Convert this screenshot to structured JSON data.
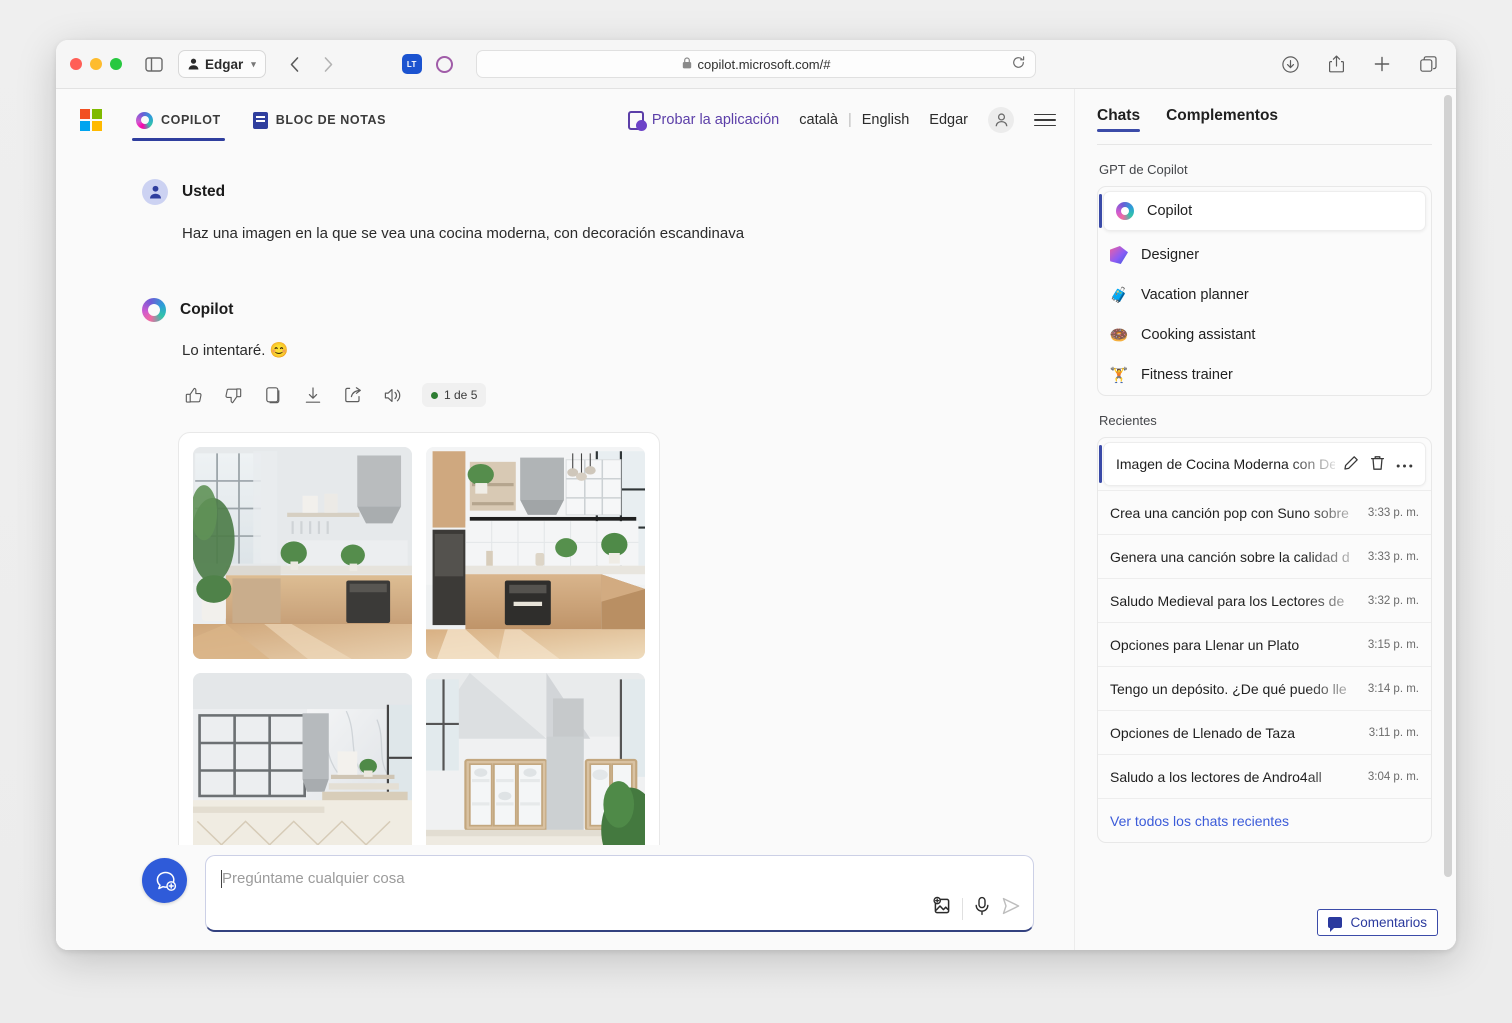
{
  "browser": {
    "profile_name": "Edgar",
    "url": "copilot.microsoft.com/#",
    "lock_icon": "lock-icon",
    "reload_icon": "reload-icon",
    "back_icon": "chevron-left-icon",
    "forward_icon": "chevron-right-icon",
    "sidebar_icon": "sidebar-toggle-icon",
    "extension_lt_label": "LT",
    "extension_circle_icon": "circle-icon",
    "right_icons": [
      "download-icon",
      "share-icon",
      "new-tab-icon",
      "tab-overview-icon"
    ]
  },
  "app_header": {
    "logo": "microsoft-logo",
    "tabs": [
      {
        "label": "COPILOT",
        "icon": "copilot-icon",
        "active": true
      },
      {
        "label": "BLOC DE NOTAS",
        "icon": "notebook-icon",
        "active": false
      }
    ],
    "try_app_label": "Probar la aplicación",
    "try_app_icon": "mobile-app-icon",
    "languages": [
      "català",
      "English"
    ],
    "language_separator": "|",
    "user_name": "Edgar",
    "avatar_icon": "person-icon",
    "menu_icon": "hamburger-menu-icon"
  },
  "conversation": {
    "user": {
      "author": "Usted",
      "avatar_icon": "user-avatar-icon",
      "text": "Haz una imagen en la que se vea una cocina moderna, con decoración escandinava"
    },
    "assistant": {
      "author": "Copilot",
      "avatar_icon": "copilot-avatar-icon",
      "text": "Lo intentaré. 😊",
      "actions": [
        {
          "name": "thumbs-up-icon"
        },
        {
          "name": "thumbs-down-icon"
        },
        {
          "name": "copy-icon"
        },
        {
          "name": "download-icon"
        },
        {
          "name": "share-icon"
        },
        {
          "name": "speaker-icon"
        }
      ],
      "counter_badge": "1 de 5",
      "images": [
        {
          "alt": "cocina-moderna-1"
        },
        {
          "alt": "cocina-moderna-2"
        },
        {
          "alt": "cocina-moderna-3"
        },
        {
          "alt": "cocina-moderna-4"
        }
      ]
    }
  },
  "composer": {
    "new_chat_icon": "new-chat-icon",
    "placeholder": "Pregúntame cualquier cosa",
    "value": "",
    "tools": [
      {
        "name": "add-image-icon"
      },
      {
        "name": "microphone-icon"
      },
      {
        "name": "send-icon"
      }
    ]
  },
  "sidebar": {
    "tabs": [
      {
        "label": "Chats",
        "active": true
      },
      {
        "label": "Complementos",
        "active": false
      }
    ],
    "gpt_section_label": "GPT de Copilot",
    "gpts": [
      {
        "label": "Copilot",
        "icon": "copilot-icon",
        "selected": true
      },
      {
        "label": "Designer",
        "icon": "designer-icon",
        "selected": false
      },
      {
        "label": "Vacation planner",
        "icon": "🧳",
        "selected": false
      },
      {
        "label": "Cooking assistant",
        "icon": "🍩",
        "selected": false
      },
      {
        "label": "Fitness trainer",
        "icon": "🏋",
        "selected": false
      }
    ],
    "recent_section_label": "Recientes",
    "recents": [
      {
        "title": "Imagen de Cocina Moderna con Decoración",
        "time": "",
        "selected": true,
        "actions": [
          "edit-icon",
          "delete-icon",
          "more-options-icon"
        ]
      },
      {
        "title": "Crea una canción pop con Suno sobre",
        "time": "3:33 p. m.",
        "selected": false
      },
      {
        "title": "Genera una canción sobre la calidad d",
        "time": "3:33 p. m.",
        "selected": false
      },
      {
        "title": "Saludo Medieval para los Lectores de",
        "time": "3:32 p. m.",
        "selected": false
      },
      {
        "title": "Opciones para Llenar un Plato",
        "time": "3:15 p. m.",
        "selected": false
      },
      {
        "title": "Tengo un depósito. ¿De qué puedo lle",
        "time": "3:14 p. m.",
        "selected": false
      },
      {
        "title": "Opciones de Llenado de Taza",
        "time": "3:11 p. m.",
        "selected": false
      },
      {
        "title": "Saludo a los lectores de Andro4all",
        "time": "3:04 p. m.",
        "selected": false
      }
    ],
    "see_all_label": "Ver todos los chats recientes"
  },
  "feedback": {
    "label": "Comentarios",
    "icon": "feedback-bubble-icon"
  },
  "colors": {
    "accent_blue": "#3b4ba8",
    "link_blue": "#3b5bd9",
    "purple": "#5b3ea8",
    "green_dot": "#2e7d32"
  }
}
